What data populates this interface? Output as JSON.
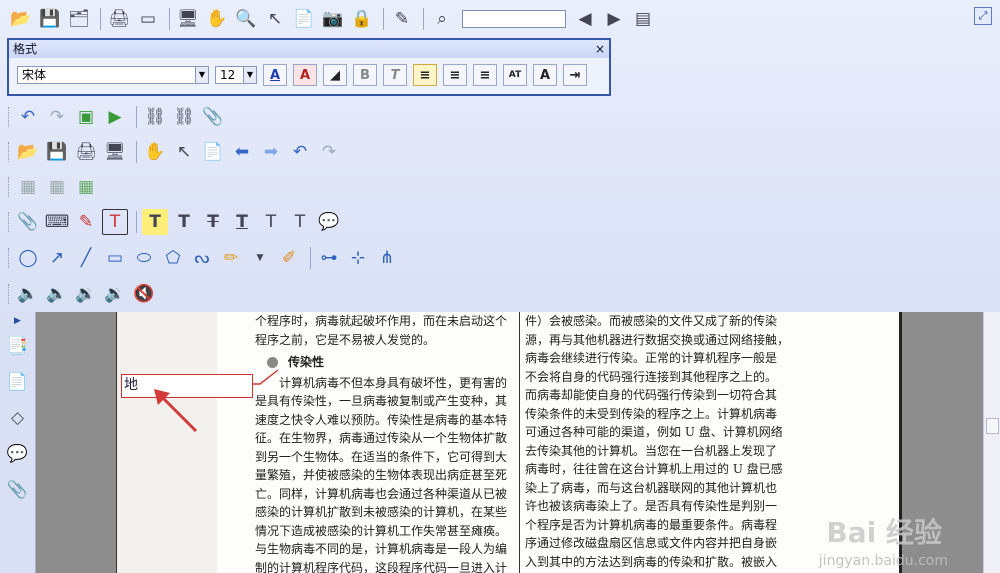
{
  "toolbar": {
    "search_value": "",
    "row1_icons": [
      "open-folder-icon",
      "save-icon",
      "save-all-icon",
      "print-icon",
      "scan-icon",
      "monitor-icon",
      "hand-icon",
      "find-icon",
      "select-arrow-icon",
      "properties-icon",
      "snapshot-camera-icon",
      "lock-rms-icon",
      "sign-pen-icon",
      "binoculars-icon"
    ],
    "row3_icons": [
      "undo-icon",
      "redo-icon",
      "insert-image-icon",
      "play-icon",
      "link-icon",
      "link-broken-icon",
      "attach-icon"
    ],
    "row4_icons": [
      "open-folder-icon",
      "save-icon",
      "print-icon",
      "monitor-icon",
      "hand-icon",
      "select-arrow-icon",
      "properties-icon",
      "prev-icon",
      "next-icon",
      "undo-icon",
      "redo-icon"
    ],
    "row5_icons": [
      "page-icon",
      "page-insert-icon",
      "page-replace-icon"
    ],
    "row6_icons": [
      "clip-icon",
      "typewriter-icon",
      "edit-box-icon",
      "textbox-icon",
      "highlight-text-icon",
      "text-icon",
      "strikeout-icon",
      "underline-icon",
      "replace-text-icon",
      "insert-text-icon",
      "comment-icon"
    ],
    "row7_icons": [
      "circle-icon",
      "arrow-icon",
      "line-icon",
      "rectangle-icon",
      "ellipse-icon",
      "pentagon-icon",
      "squiggle-icon",
      "pencil-icon",
      "eraser-icon",
      "distance-icon",
      "perimeter-icon",
      "area-icon"
    ],
    "row8_icons": [
      "audio-icon",
      "audio-next-icon",
      "sound-icon",
      "sound2-icon",
      "sound3-icon"
    ]
  },
  "format_panel": {
    "title": "格式",
    "close": "×",
    "font_name": "宋体",
    "font_size": "12",
    "bold": "B",
    "italic": "T",
    "font_color_label": "A",
    "highlight_label": "A"
  },
  "sidebar_icons": [
    "pages-icon",
    "bookmark-icon",
    "layers-icon",
    "comments-icon",
    "attachments-icon"
  ],
  "document": {
    "left_lines": [
      "个程序时，病毒就起破坏作用，而在未启动这个",
      "程序之前，它是不易被人发觉的。"
    ],
    "heading": "传染性",
    "left_body": [
      "计算机病毒不但本身具有破坏性，更有害的",
      "是具有传染性，一旦病毒被复制或产生变种，其",
      "速度之快令人难以预防。传染性是病毒的基本特",
      "征。在生物界，病毒通过传染从一个生物体扩散",
      "到另一个生物体。在适当的条件下，它可得到大",
      "量繁殖，并使被感染的生物体表现出病症甚至死",
      "亡。同样，计算机病毒也会通过各种渠道从已被",
      "感染的计算机扩散到未被感染的计算机，在某些",
      "情况下造成被感染的计算机工作失常甚至瘫痪。",
      "与生物病毒不同的是，计算机病毒是一段人为编",
      "制的计算机程序代码，这段程序代码一旦进入计"
    ],
    "right_body": [
      "件）会被感染。而被感染的文件又成了新的传染",
      "源，再与其他机器进行数据交换或通过网络接触，",
      "病毒会继续进行传染。正常的计算机程序一般是",
      "不会将自身的代码强行连接到其他程序之上的。",
      "而病毒却能使自身的代码强行传染到一切符合其",
      "传染条件的未受到传染的程序之上。计算机病毒",
      "可通过各种可能的渠道，例如 U 盘、计算机网络",
      "去传染其他的计算机。当您在一台机器上发现了",
      "病毒时，往往曾在这台计算机上用过的 U 盘已感",
      "染上了病毒，而与这台机器联网的其他计算机也",
      "许也被该病毒染上了。是否具有传染性是判别一",
      "个程序是否为计算机病毒的最重要条件。病毒程",
      "序通过修改磁盘扇区信息或文件内容并把自身嵌",
      "入到其中的方法达到病毒的传染和扩散。被嵌入"
    ]
  },
  "annotation": {
    "text": "地"
  },
  "watermark": {
    "brand": "Bai 经验",
    "url": "jingyan.baidu.com"
  },
  "colors": {
    "accent": "#3856a6",
    "annotation_border": "#cc3333",
    "arrow": "#d33a3a"
  }
}
